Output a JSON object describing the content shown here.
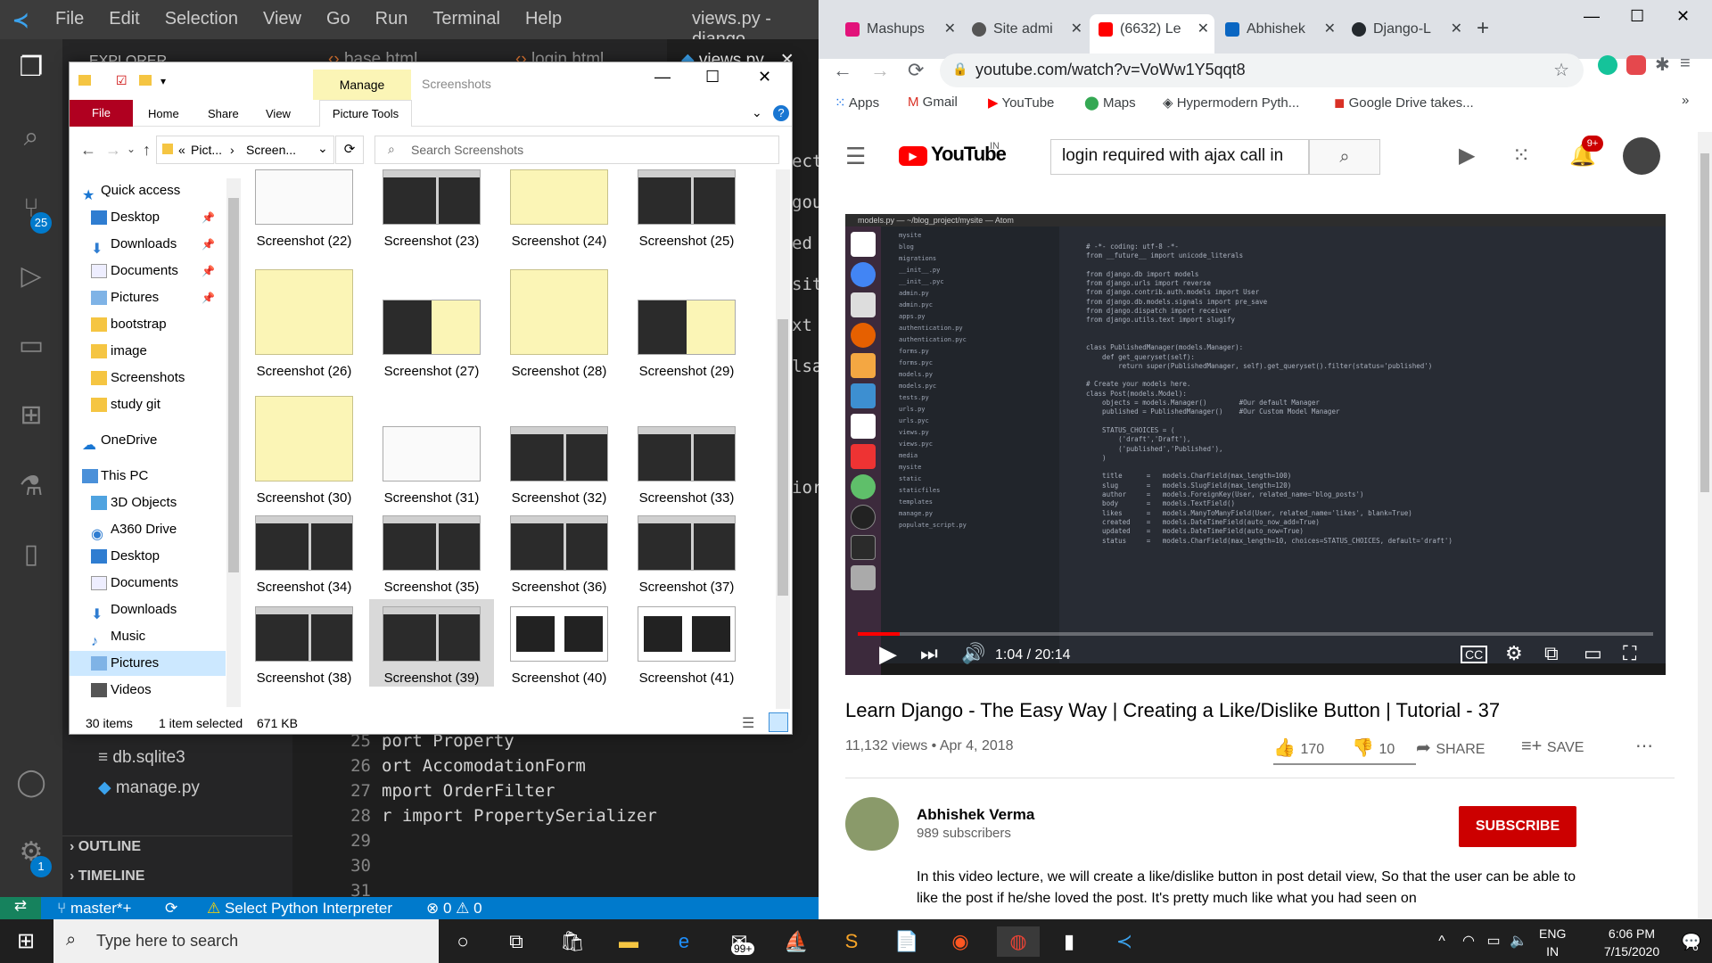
{
  "vscode": {
    "menu": [
      "File",
      "Edit",
      "Selection",
      "View",
      "Go",
      "Run",
      "Terminal",
      "Help"
    ],
    "window_title": "views.py - django",
    "explorer_title": "EXPLORER",
    "tabs": [
      {
        "label": "base.html"
      },
      {
        "label": "login.html"
      },
      {
        "label": "views.py"
      }
    ],
    "source_control_badge": "25",
    "settings_badge": "1",
    "side_items": [
      "db.sqlite3",
      "manage.py"
    ],
    "sections": [
      "OUTLINE",
      "TIMELINE"
    ],
    "editor_peek": [
      "ect",
      "gou",
      "ed",
      "sit",
      "xt",
      "lsa",
      "ior"
    ],
    "code_lines": [
      {
        "no": "25",
        "text": "port Property"
      },
      {
        "no": "26",
        "text": "ort AccomodationForm"
      },
      {
        "no": "27",
        "text": "mport OrderFilter"
      },
      {
        "no": "28",
        "text": "r import PropertySerializer"
      },
      {
        "no": "29",
        "text": ""
      },
      {
        "no": "30",
        "text": ""
      },
      {
        "no": "31",
        "text": ""
      }
    ],
    "status": {
      "branch": "master*+",
      "interpreter": "Select Python Interpreter",
      "errors": "0",
      "warnings": "0"
    }
  },
  "explorer": {
    "manage_label": "Manage",
    "title": "Screenshots",
    "ribbon": [
      "File",
      "Home",
      "Share",
      "View",
      "Picture Tools"
    ],
    "breadcrumb": [
      "Pict...",
      "Screen..."
    ],
    "breadcrumb_prefix": "«",
    "search_placeholder": "Search Screenshots",
    "tree": [
      "Quick access",
      "Desktop",
      "Downloads",
      "Documents",
      "Pictures",
      "bootstrap",
      "image",
      "Screenshots",
      "study git",
      "OneDrive",
      "This PC",
      "3D Objects",
      "A360 Drive",
      "Desktop",
      "Documents",
      "Downloads",
      "Music",
      "Pictures",
      "Videos"
    ],
    "thumbs": [
      "Screenshot (22)",
      "Screenshot (23)",
      "Screenshot (24)",
      "Screenshot (25)",
      "Screenshot (26)",
      "Screenshot (27)",
      "Screenshot (28)",
      "Screenshot (29)",
      "Screenshot (30)",
      "Screenshot (31)",
      "Screenshot (32)",
      "Screenshot (33)",
      "Screenshot (34)",
      "Screenshot (35)",
      "Screenshot (36)",
      "Screenshot (37)",
      "Screenshot (38)",
      "Screenshot (39)",
      "Screenshot (40)",
      "Screenshot (41)"
    ],
    "status_items": "30 items",
    "status_selected": "1 item selected",
    "status_size": "671 KB"
  },
  "chrome": {
    "tabs": [
      {
        "label": "Mashups",
        "fav": "#e2127a"
      },
      {
        "label": "Site admi",
        "fav": "#555"
      },
      {
        "label": "(6632) Le",
        "fav": "#f00"
      },
      {
        "label": "Abhishek",
        "fav": "#0a66c2"
      },
      {
        "label": "Django-L",
        "fav": "#24292e"
      }
    ],
    "url": "youtube.com/watch?v=VoWw1Y5qqt8",
    "bookmarks": [
      "Apps",
      "Gmail",
      "YouTube",
      "Maps",
      "Hypermodern Pyth...",
      "Google Drive takes..."
    ]
  },
  "youtube": {
    "logo": "YouTube",
    "region": "IN",
    "search": "login required with ajax call in",
    "notif_badge": "9+",
    "time": "1:04 / 20:14",
    "video_title": "Learn Django - The Easy Way | Creating a Like/Dislike Button | Tutorial - 37",
    "views": "11,132 views",
    "date": "Apr 4, 2018",
    "likes": "170",
    "dislikes": "10",
    "share": "SHARE",
    "save": "SAVE",
    "channel": "Abhishek Verma",
    "subs": "989 subscribers",
    "subscribe": "SUBSCRIBE",
    "description": "In this video lecture, we will create a like/dislike button in post detail view, So that the user can be able to like the post if he/she loved the post. It's pretty much like what you had seen on",
    "atom_title": "models.py — ~/blog_project/mysite — Atom",
    "atom_files": [
      "mysite",
      "blog",
      "migrations",
      "__init__.py",
      "__init__.pyc",
      "admin.py",
      "admin.pyc",
      "apps.py",
      "authentication.py",
      "authentication.pyc",
      "forms.py",
      "forms.pyc",
      "models.py",
      "models.pyc",
      "tests.py",
      "urls.py",
      "urls.pyc",
      "views.py",
      "views.pyc",
      "media",
      "mysite",
      "static",
      "staticfiles",
      "templates",
      "manage.py",
      "populate_script.py"
    ],
    "atom_code": [
      "# -*- coding: utf-8 -*-",
      "from __future__ import unicode_literals",
      "",
      "from django.db import models",
      "from django.urls import reverse",
      "from django.contrib.auth.models import User",
      "from django.db.models.signals import pre_save",
      "from django.dispatch import receiver",
      "from django.utils.text import slugify",
      "",
      "",
      "class PublishedManager(models.Manager):",
      "    def get_queryset(self):",
      "        return super(PublishedManager, self).get_queryset().filter(status='published')",
      "",
      "# Create your models here.",
      "class Post(models.Model):",
      "    objects = models.Manager()        #Our default Manager",
      "    published = PublishedManager()    #Our Custom Model Manager",
      "",
      "    STATUS_CHOICES = (",
      "        ('draft','Draft'),",
      "        ('published','Published'),",
      "    )",
      "",
      "    title      =   models.CharField(max_length=100)",
      "    slug       =   models.SlugField(max_length=120)",
      "    author     =   models.ForeignKey(User, related_name='blog_posts')",
      "    body       =   models.TextField()",
      "    likes      =   models.ManyToManyField(User, related_name='likes', blank=True)",
      "    created    =   models.DateTimeField(auto_now_add=True)",
      "    updated    =   models.DateTimeField(auto_now=True)",
      "    status     =   models.CharField(max_length=10, choices=STATUS_CHOICES, default='draft')"
    ],
    "progress": 0.053
  },
  "taskbar": {
    "search": "Type here to search",
    "mail_badge": "99+",
    "lang1": "ENG",
    "lang2": "IN",
    "time": "6:06 PM",
    "date": "7/15/2020",
    "notif": "6"
  }
}
